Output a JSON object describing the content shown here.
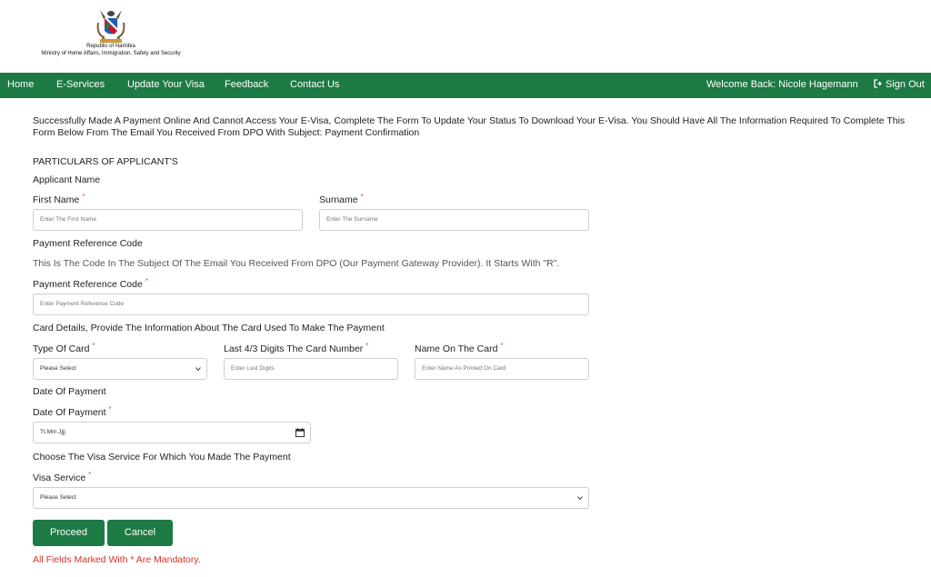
{
  "header": {
    "logo_icon": "coat-of-arms-icon",
    "republic": "Republic of Namibia",
    "ministry": "Ministry of Home Affairs, Immigration, Safety and Security"
  },
  "nav": {
    "background": "#1d7a44",
    "items": [
      "Home",
      "E-Services",
      "Update Your Visa",
      "Feedback",
      "Contact Us"
    ],
    "welcome": "Welcome Back: Nicole Hagemann",
    "signout": "Sign Out",
    "signout_icon": "sign-out-icon"
  },
  "intro": "Successfully Made A Payment Online And Cannot Access Your E-Visa, Complete The Form To Update Your Status To Download Your E-Visa. You Should Have All The Information Required To Complete This Form Below From The Email You Received From DPO With Subject: Payment Confirmation",
  "form": {
    "section_title": "PARTICULARS OF APPLICANT'S",
    "applicant_name": "Applicant Name",
    "first_name": {
      "label": "First Name",
      "placeholder": "Enter The First Name"
    },
    "surname": {
      "label": "Surname",
      "placeholder": "Enter The Surname"
    },
    "payment_ref_heading": "Payment Reference Code",
    "payment_ref_help": "This Is The Code In The Subject Of The Email You Received From DPO (Our Payment Gateway Provider). It Starts With \"R\".",
    "payment_ref": {
      "label": "Payment Reference Code",
      "placeholder": "Enter Payment Reference Code"
    },
    "card_heading": "Card Details, Provide The Information About The Card Used To Make The Payment",
    "card_type": {
      "label": "Type Of Card",
      "value": "Please Select"
    },
    "last_digits": {
      "label": "Last 4/3 Digits The Card Number",
      "placeholder": "Enter Last Digits"
    },
    "name_on_card": {
      "label": "Name On The Card",
      "placeholder": "Enter Name As Printed On Card"
    },
    "date_heading": "Date Of Payment",
    "date": {
      "label": "Date Of Payment",
      "value": "Tt.Mm.Jjjj"
    },
    "visa_heading": "Choose The Visa Service For Which You Made The Payment",
    "visa_service": {
      "label": "Visa Service",
      "value": "Please Select"
    },
    "required_mark": "*",
    "proceed": "Proceed",
    "cancel": "Cancel",
    "mandatory_note": "All Fields Marked With * Are Mandatory."
  }
}
